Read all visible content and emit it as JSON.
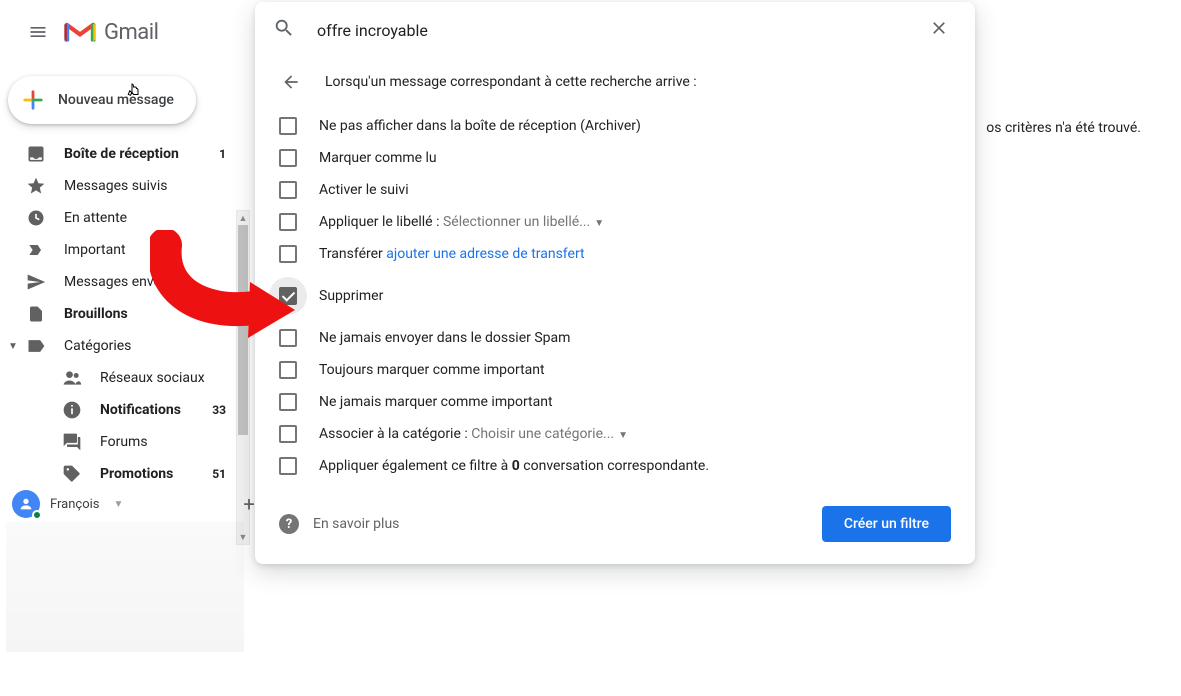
{
  "header": {
    "app_name": "Gmail",
    "search_value": "offre incroyable"
  },
  "compose_label": "Nouveau message",
  "sidebar": {
    "items": [
      {
        "label": "Boîte de réception",
        "count": "1",
        "bold": true
      },
      {
        "label": "Messages suivis"
      },
      {
        "label": "En attente"
      },
      {
        "label": "Important"
      },
      {
        "label": "Messages envoyés"
      },
      {
        "label": "Brouillons",
        "bold": true
      },
      {
        "label": "Catégories"
      }
    ],
    "categories": [
      {
        "label": "Réseaux sociaux"
      },
      {
        "label": "Notifications",
        "count": "33",
        "bold": true
      },
      {
        "label": "Forums"
      },
      {
        "label": "Promotions",
        "count": "51",
        "bold": true
      }
    ]
  },
  "hangouts": {
    "user_name": "François"
  },
  "filter_panel": {
    "title": "Lorsqu'un message correspondant à cette recherche arrive :",
    "options": {
      "skip_inbox": "Ne pas afficher dans la boîte de réception (Archiver)",
      "mark_read": "Marquer comme lu",
      "star": "Activer le suivi",
      "apply_label_prefix": "Appliquer le libellé : ",
      "apply_label_select": "Sélectionner un libellé...",
      "forward_prefix": "Transférer   ",
      "forward_link": "ajouter une adresse de transfert",
      "delete": "Supprimer",
      "never_spam": "Ne jamais envoyer dans le dossier Spam",
      "always_important": "Toujours marquer comme important",
      "never_important": "Ne jamais marquer comme important",
      "categorize_prefix": "Associer à la catégorie : ",
      "categorize_select": "Choisir une catégorie...",
      "also_apply_prefix": "Appliquer également ce filtre à ",
      "also_apply_count": "0",
      "also_apply_suffix": " conversation correspondante."
    },
    "learn_more": "En savoir plus",
    "create_button": "Créer un filtre"
  },
  "background_message": "os critères n'a été trouvé."
}
